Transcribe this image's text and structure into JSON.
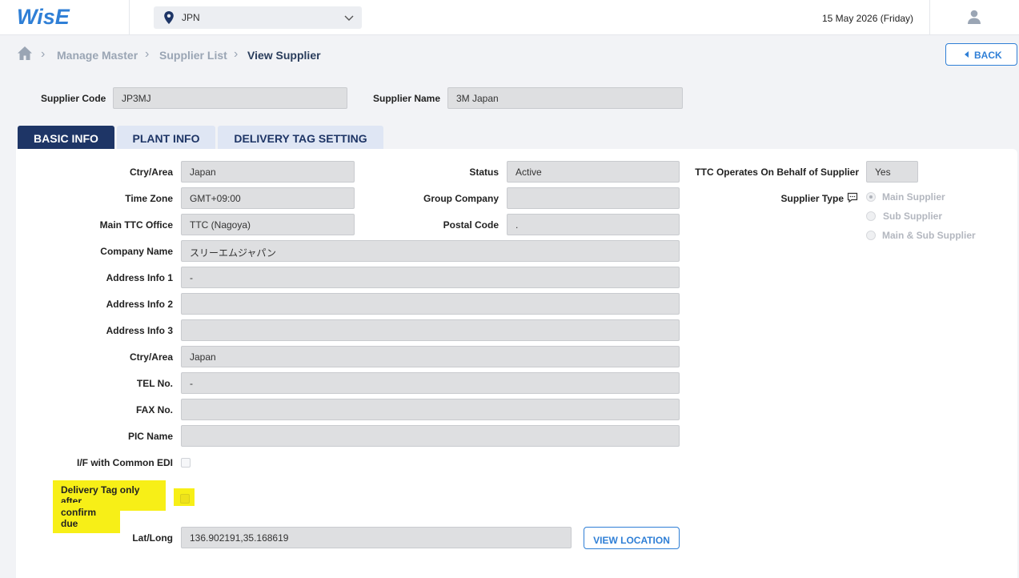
{
  "header": {
    "logo": "WisE",
    "region": "JPN",
    "date": "15 May 2026 (Friday)"
  },
  "breadcrumb": {
    "items": [
      "Manage Master",
      "Supplier List",
      "View Supplier"
    ],
    "back_label": "BACK"
  },
  "supplier": {
    "code_label": "Supplier Code",
    "code_value": "JP3MJ",
    "name_label": "Supplier Name",
    "name_value": "3M Japan"
  },
  "tabs": [
    "BASIC INFO",
    "PLANT INFO",
    "DELIVERY TAG SETTING"
  ],
  "basic": {
    "ctry_label": "Ctry/Area",
    "ctry_value": "Japan",
    "tz_label": "Time Zone",
    "tz_value": "GMT+09:00",
    "office_label": "Main TTC Office",
    "office_value": "TTC (Nagoya)",
    "company_label": "Company Name",
    "company_value": "スリーエムジャパン",
    "addr1_label": "Address Info 1",
    "addr1_value": "-",
    "addr2_label": "Address Info 2",
    "addr2_value": "",
    "addr3_label": "Address Info 3",
    "addr3_value": "",
    "ctry2_label": "Ctry/Area",
    "ctry2_value": "Japan",
    "tel_label": "TEL No.",
    "tel_value": "-",
    "fax_label": "FAX No.",
    "fax_value": "",
    "pic_label": "PIC Name",
    "pic_value": "",
    "edi_label": "I/F with Common EDI",
    "deliv_line1": "Delivery Tag only after",
    "deliv_line2": "confirm due",
    "latlong_label": "Lat/Long",
    "latlong_value": "136.902191,35.168619",
    "view_location": "VIEW LOCATION",
    "status_label": "Status",
    "status_value": "Active",
    "group_label": "Group Company",
    "group_value": "",
    "postal_label": "Postal Code",
    "postal_value": ".",
    "ttc_label": "TTC Operates On Behalf of Supplier",
    "ttc_value": "Yes",
    "type_label": "Supplier Type",
    "type_options": [
      "Main Supplier",
      "Sub Supplier",
      "Main & Sub Supplier"
    ]
  },
  "colors": {
    "accent": "#2f7fd6",
    "navy": "#1e3566",
    "highlight": "#f7ef17"
  }
}
